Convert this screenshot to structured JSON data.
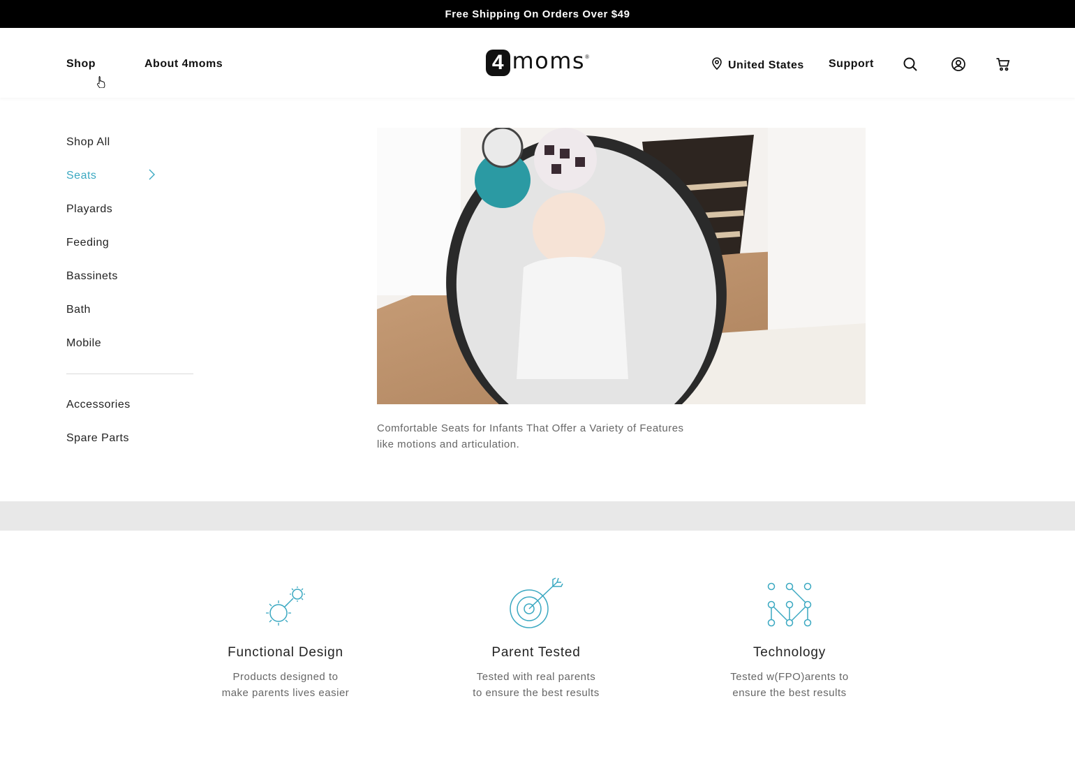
{
  "promo": {
    "text": "Free Shipping On Orders Over $49"
  },
  "header": {
    "nav": {
      "shop": "Shop",
      "about": "About 4moms"
    },
    "logo": {
      "badge": "4",
      "text": "moms",
      "tm": "®"
    },
    "locale": "United States",
    "support": "Support",
    "icons": [
      "location-pin-icon",
      "search-icon",
      "account-icon",
      "cart-icon"
    ]
  },
  "sidebar": {
    "items": [
      {
        "label": "Shop All"
      },
      {
        "label": "Seats",
        "active": true
      },
      {
        "label": "Playards"
      },
      {
        "label": "Feeding"
      },
      {
        "label": "Bassinets"
      },
      {
        "label": "Bath"
      },
      {
        "label": "Mobile"
      }
    ],
    "secondary": [
      {
        "label": "Accessories"
      },
      {
        "label": "Spare Parts"
      }
    ]
  },
  "hero": {
    "caption": "Comfortable Seats for Infants That Offer a Variety of Features like motions and articulation."
  },
  "features": [
    {
      "icon": "gears-icon",
      "title": "Functional Design",
      "desc": [
        "Products designed to",
        "make parents lives easier"
      ]
    },
    {
      "icon": "target-icon",
      "title": "Parent Tested",
      "desc": [
        "Tested with real parents",
        "to ensure the best results"
      ]
    },
    {
      "icon": "circuit-icon",
      "title": "Technology",
      "desc": [
        "Tested w(FPO)arents to",
        "ensure the best results"
      ]
    }
  ],
  "colors": {
    "accent": "#3aa8c1",
    "promo_bg": "#000000",
    "band": "#e8e8e8"
  }
}
